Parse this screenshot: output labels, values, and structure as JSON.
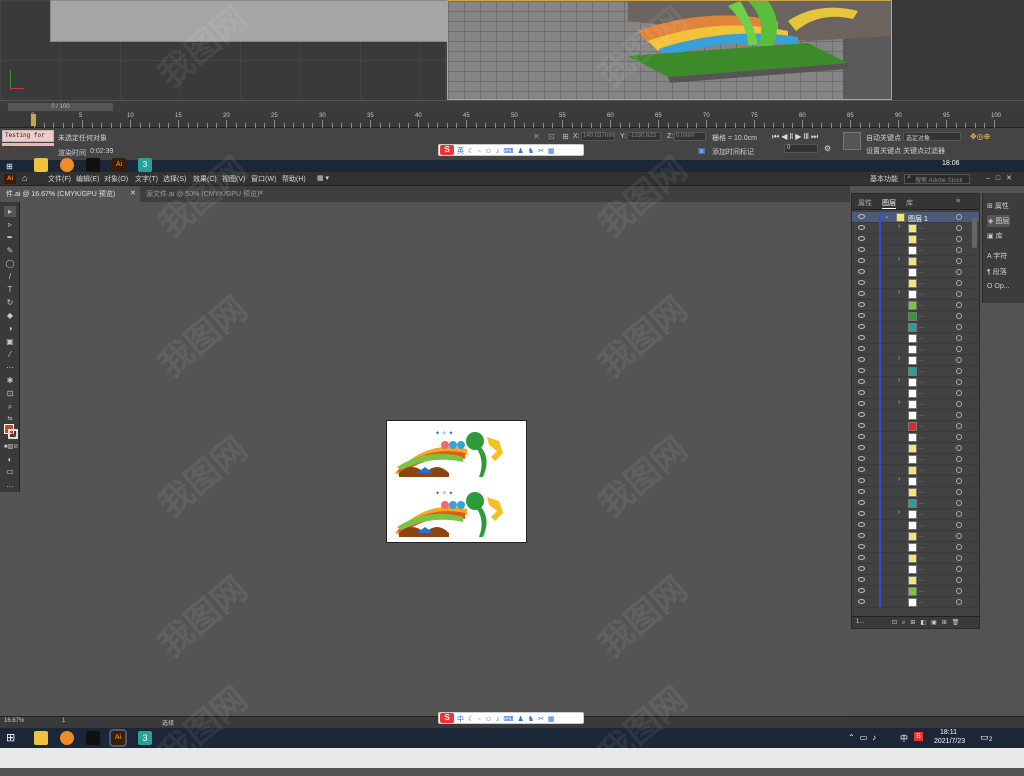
{
  "max": {
    "timeline_value": "0 / 100",
    "ruler_labels": [
      "0",
      "5",
      "10",
      "15",
      "20",
      "25",
      "30",
      "35",
      "40",
      "45",
      "50",
      "55",
      "60",
      "65",
      "70",
      "75",
      "80",
      "85",
      "90",
      "95",
      "100"
    ],
    "testing_label": "Testing for AI",
    "no_selection": "未选定任何对象",
    "render_time_label": "渲染时间",
    "render_time": "0:02:39",
    "x_label": "X:",
    "x_value": "140.037mm",
    "y_label": "Y:",
    "y_value": "-1330.623",
    "z_label": "Z:",
    "z_value": "0.0mm",
    "grid_label": "栅格 = 10.0cm",
    "add_time_tag": "添加时间标记",
    "auto_key": "自动关键点",
    "selected_object": "选定对象",
    "set_key": "设置关键点",
    "key_filter": "关键点过滤器",
    "frame": "0",
    "clock_top": "18:06"
  },
  "ai": {
    "logo": "Ai",
    "menus": [
      "文件(F)",
      "编辑(E)",
      "对象(O)",
      "文字(T)",
      "选择(S)",
      "效果(C)",
      "视图(V)",
      "窗口(W)",
      "帮助(H)"
    ],
    "workspace": "基本功能",
    "search_placeholder": "搜索 Adobe Stock",
    "tab1": "件.ai @ 16.67% (CMYK/GPU 预览)",
    "tab2": "源文件.ai @ 50% (CMYK/GPU 预览)",
    "panel_tabs": [
      "属性",
      "图层",
      "库"
    ],
    "layer_name": "图层 1",
    "panel_footer": "1...",
    "dock_items": [
      "属性",
      "图层",
      "库",
      "字符",
      "段落",
      "Op..."
    ],
    "zoom": "16.67%",
    "page": "1",
    "status_tool": "选择"
  },
  "taskbar": {
    "time": "18:11",
    "date": "2021/7/23",
    "tray_lang": "中",
    "notifications": "2"
  },
  "ime": {
    "mode_top": "英",
    "mode_bottom": "中"
  },
  "watermark": "我图网"
}
